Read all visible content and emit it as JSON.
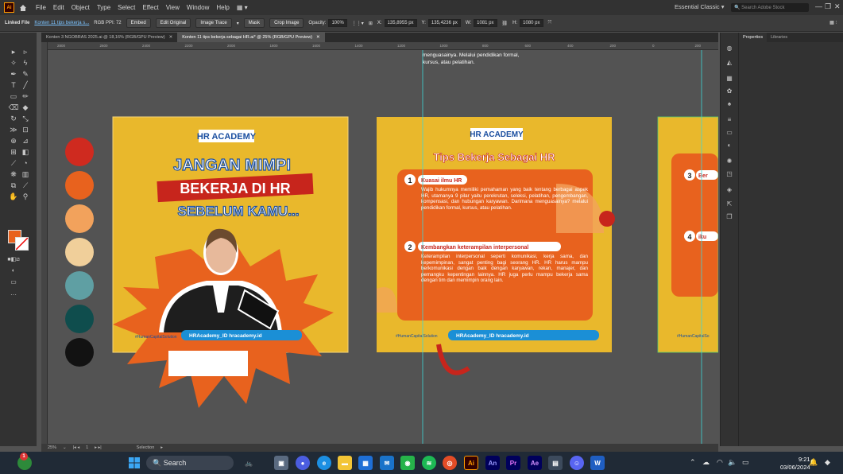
{
  "menubar": {
    "app_badge": "Ai",
    "items": [
      "File",
      "Edit",
      "Object",
      "Type",
      "Select",
      "Effect",
      "View",
      "Window",
      "Help"
    ],
    "workspace": "Essential Classic",
    "search_placeholder": "Search Adobe Stock"
  },
  "controlbar": {
    "selection": "Linked File",
    "filename": "Konten 11 tips bekerja s...",
    "mode": "RGB  PPI: 72",
    "embed": "Embed",
    "edit_original": "Edit Original",
    "image_trace": "Image Trace",
    "mask": "Mask",
    "crop": "Crop Image",
    "opacity_label": "Opacity:",
    "opacity": "100%",
    "x_label": "X:",
    "x_value": "135,8955 px",
    "y_label": "Y:",
    "y_value": "135,4236 px",
    "w_label": "W:",
    "w_value": "1081 px",
    "h_label": "H:",
    "h_value": "1080 px"
  },
  "tabs": [
    {
      "label": "Konten 3 NGOBRAS 2025.ai @ 18,16% (RGB/GPU Preview)"
    },
    {
      "label": "Konten 11 tips bekerja sebagai HR.ai* @ 25% (RGB/GPU Preview)"
    }
  ],
  "ruler": [
    "2800",
    "2600",
    "2400",
    "2200",
    "2000",
    "1800",
    "1600",
    "1400",
    "1200",
    "1000",
    "800",
    "600",
    "400",
    "200",
    "0",
    "200"
  ],
  "swatches": [
    "#cf2a1f",
    "#e8621e",
    "#f2a25c",
    "#f0cf9a",
    "#5f9fa3",
    "#0f4d4d",
    "#121212"
  ],
  "artboard1": {
    "brand": "HR ACADEMY",
    "line1": "JANGAN MIMPI",
    "line2": "BEKERJA DI HR",
    "line3": "SEBELUM KAMU...",
    "hashtag": "#HumanCapitalSolution",
    "footer": "HRAcademy_ID   hracademy.id"
  },
  "artboard2": {
    "brand": "HR ACADEMY",
    "title": "Tips Bekerja Sebagai HR",
    "above_text_1": "menguasainya. Melalui pendidikan formal,",
    "above_text_2": "kursus, atau pelatihan.",
    "tip1_num": "1",
    "tip1_title": "Kuasai ilmu HR",
    "tip1_body": "Wajib hukumnya memiliki pemahaman yang baik tentang berbagai aspek HR, utamanya 9 pilar yaitu perekrutan, seleksi, pelatihan, pengembangan, kompensasi, dan hubungan karyawan. Darimana menguasainya? melalui pendidikan formal, kursus, atau pelatihan.",
    "tip2_num": "2",
    "tip2_title": "Kembangkan keterampilan interpersonal",
    "tip2_body": "Keterampilan interpersonal seperti komunikasi, kerja sama, dan kepemimpinan, sangat penting bagi seorang HR. HR harus mampu berkomunikasi dengan baik dengan karyawan, rekan, manajer, dan pemangku kepentingan lainnya. HR juga perlu mampu bekerja sama dengan tim dan memimpin orang lain.",
    "hashtag": "#HumanCapitalSolution",
    "footer": "HRAcademy_ID   hracademy.id"
  },
  "artboard3": {
    "tip3_num": "3",
    "tip3_title": "Ber",
    "tip4_num": "4",
    "tip4_title": "iku",
    "hashtag": "#HumanCapitalSo"
  },
  "props": {
    "tab_properties": "Properties",
    "tab_libraries": "Libraries"
  },
  "statusbar": {
    "zoom": "25%",
    "page": "1",
    "tool": "Selection"
  },
  "taskbar": {
    "search": "Search",
    "time": "9:21",
    "date": "03/06/2024",
    "notification_count": "1"
  },
  "colors": {
    "orange": "#e8621e",
    "yellow": "#e9b82c",
    "red": "#c7251c",
    "guide": "#3fd6d6"
  }
}
